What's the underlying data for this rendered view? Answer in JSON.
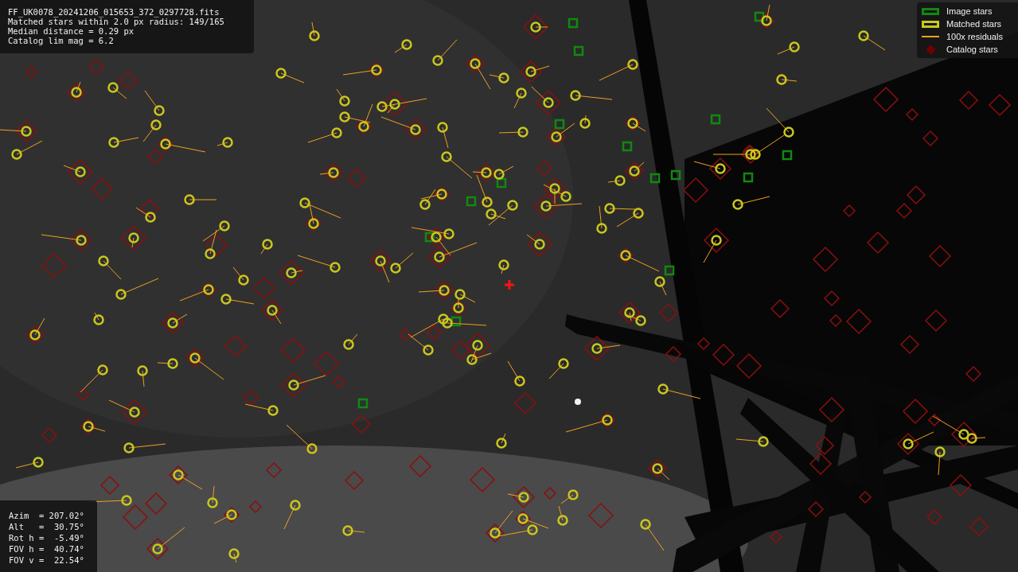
{
  "info_box": {
    "lines": [
      "FF_UK0078_20241206_015653_372_0297728.fits",
      "Matched stars within 2.0 px radius: 149/165",
      "Median distance = 0.29 px",
      "Catalog lim mag = 6.2"
    ]
  },
  "pointing_box": {
    "lines": [
      "Azim  = 207.02°",
      "Alt   =  30.75°",
      "Rot h =  -5.49°",
      "FOV h =  40.74°",
      "FOV v =  22.54°"
    ]
  },
  "legend": [
    {
      "label": "Image stars",
      "kind": "box",
      "color": "#118811"
    },
    {
      "label": "Matched stars",
      "kind": "box",
      "color": "#c8c81e"
    },
    {
      "label": "100x residuals",
      "kind": "line",
      "color": "#f0a020"
    },
    {
      "label": "Catalog stars",
      "kind": "diamond",
      "color": "#6e0000"
    }
  ]
}
